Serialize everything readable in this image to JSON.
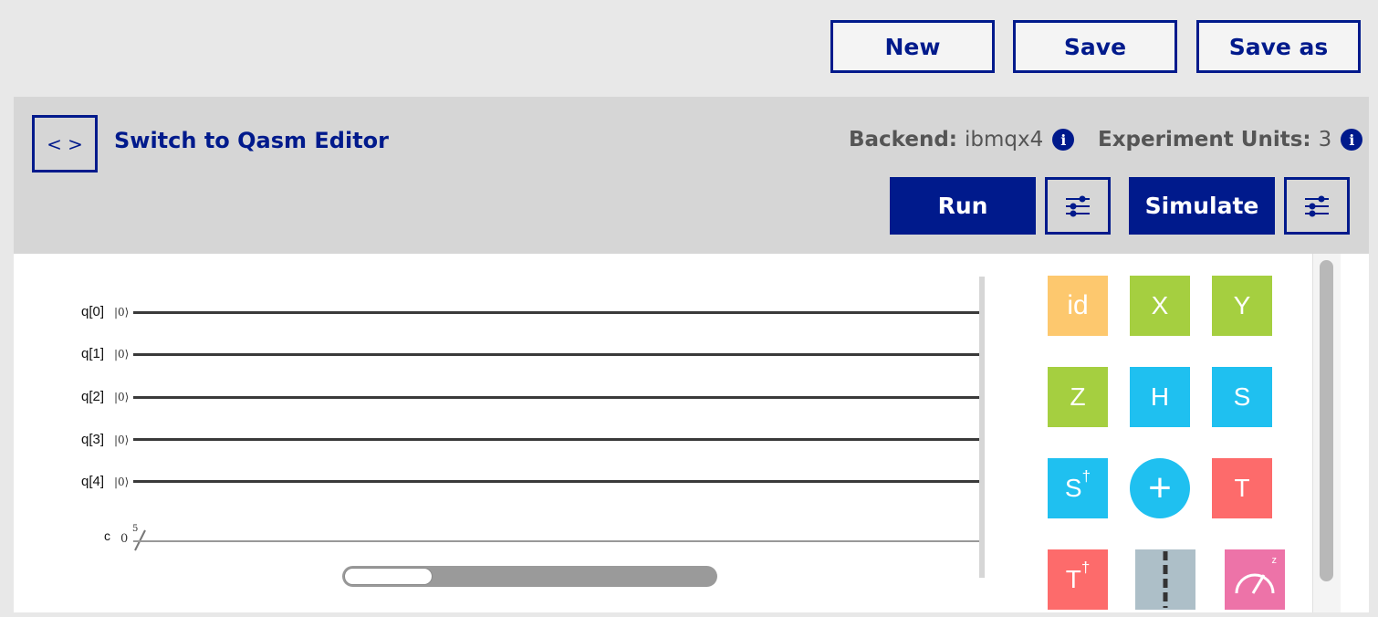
{
  "toolbar": {
    "new_label": "New",
    "save_label": "Save",
    "save_as_label": "Save as"
  },
  "panel": {
    "code_icon": "< >",
    "switch_label": "Switch to Qasm Editor",
    "backend_key": "Backend:",
    "backend_value": "ibmqx4",
    "units_key": "Experiment Units:",
    "units_value": "3",
    "info_icon": "i",
    "run_label": "Run",
    "simulate_label": "Simulate"
  },
  "circuit": {
    "qubits": [
      {
        "label": "q[0]",
        "ket": "|0⟩"
      },
      {
        "label": "q[1]",
        "ket": "|0⟩"
      },
      {
        "label": "q[2]",
        "ket": "|0⟩"
      },
      {
        "label": "q[3]",
        "ket": "|0⟩"
      },
      {
        "label": "q[4]",
        "ket": "|0⟩"
      }
    ],
    "classical": {
      "label": "c",
      "value": "0",
      "bits": "5"
    },
    "scroll_position": 0.0
  },
  "gates": [
    {
      "name": "id",
      "label": "id",
      "color": "#fdc86e"
    },
    {
      "name": "x",
      "label": "X",
      "color": "#a5cf40"
    },
    {
      "name": "y",
      "label": "Y",
      "color": "#a5cf40"
    },
    {
      "name": "z",
      "label": "Z",
      "color": "#a5cf40"
    },
    {
      "name": "h",
      "label": "H",
      "color": "#1fc0f0"
    },
    {
      "name": "s",
      "label": "S",
      "color": "#1fc0f0"
    },
    {
      "name": "sdg",
      "label": "S",
      "sup": "†",
      "color": "#1fc0f0"
    },
    {
      "name": "cnot",
      "label": "+",
      "color": "#1fc0f0"
    },
    {
      "name": "t",
      "label": "T",
      "color": "#fd6b6b"
    },
    {
      "name": "tdg",
      "label": "T",
      "sup": "†",
      "color": "#fd6b6b"
    },
    {
      "name": "barrier",
      "label": "",
      "color": "#adbfc8"
    },
    {
      "name": "measure",
      "label": "z",
      "color": "#ed73a8"
    }
  ],
  "colors": {
    "accent": "#001a8c",
    "panel": "#d6d6d6",
    "page": "#e8e8e8"
  }
}
